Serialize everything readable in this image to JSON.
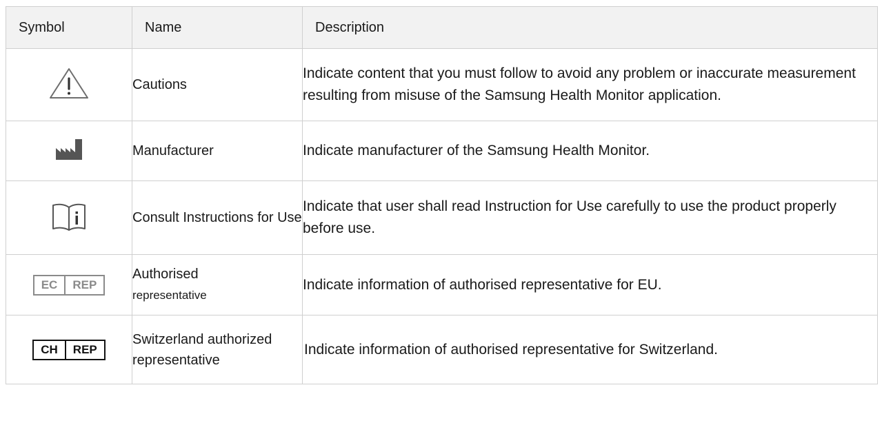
{
  "table": {
    "headers": {
      "symbol": "Symbol",
      "name": "Name",
      "description": "Description"
    },
    "rows": [
      {
        "icon": "caution-icon",
        "name": "Cautions",
        "description": "Indicate content that you must follow to avoid any problem or inaccurate measurement resulting from misuse of the Samsung Health Monitor application."
      },
      {
        "icon": "manufacturer-icon",
        "name": "Manufacturer",
        "description": "Indicate manufacturer of the Samsung Health Monitor."
      },
      {
        "icon": "consult-instructions-icon",
        "name": "Consult Instructions for Use",
        "description": "Indicate that user shall read Instruction for Use carefully to use the product properly before use."
      },
      {
        "icon": "ec-rep-icon",
        "symbol_left": "EC",
        "symbol_right": "REP",
        "name_line1": "Authorised",
        "name_line2": "representative",
        "description": "Indicate information of authorised representative for EU."
      },
      {
        "icon": "ch-rep-icon",
        "symbol_left": "CH",
        "symbol_right": "REP",
        "name": "Switzerland authorized representative",
        "description": "Indicate information of authorised representative for Switzerland."
      }
    ]
  },
  "colors": {
    "border": "#cfcfcf",
    "header_bg": "#f2f2f2",
    "icon_grey": "#8a8a8a",
    "icon_dark": "#555555"
  }
}
